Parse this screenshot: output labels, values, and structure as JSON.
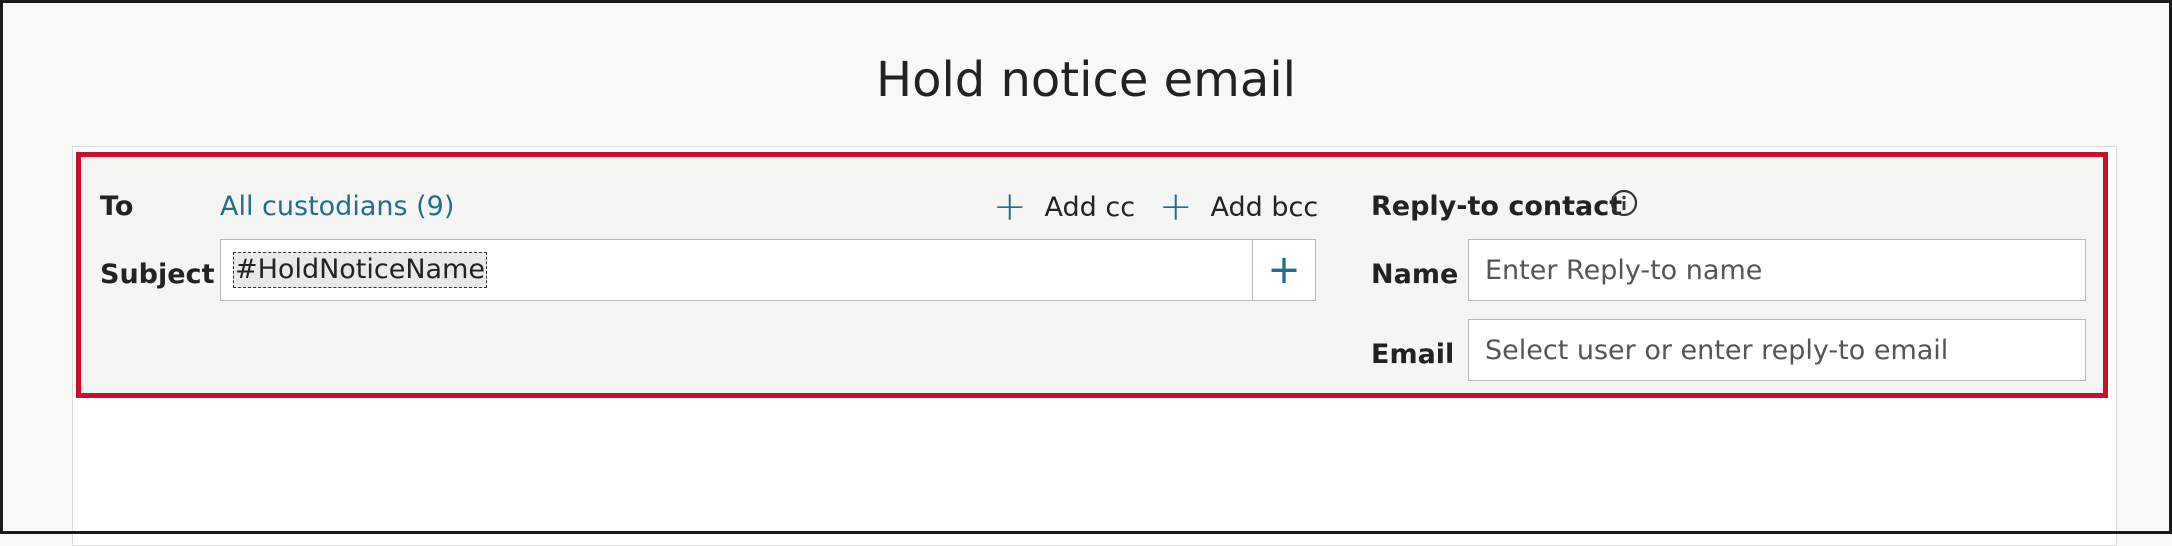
{
  "page": {
    "title": "Hold notice email"
  },
  "recipients": {
    "to_label": "To",
    "to_value": "All custodians (9)",
    "add_cc_label": "Add cc",
    "add_bcc_label": "Add bcc"
  },
  "subject": {
    "label": "Subject",
    "token": "#HoldNoticeName",
    "insert_icon": "plus-icon"
  },
  "reply_to": {
    "heading": "Reply-to contact",
    "info_icon": "info-icon",
    "name_label": "Name",
    "name_placeholder": "Enter Reply-to name",
    "email_label": "Email",
    "email_placeholder": "Select user or enter reply-to email"
  },
  "colors": {
    "accent": "#1f6f8b",
    "highlight_border": "#c8102e"
  }
}
